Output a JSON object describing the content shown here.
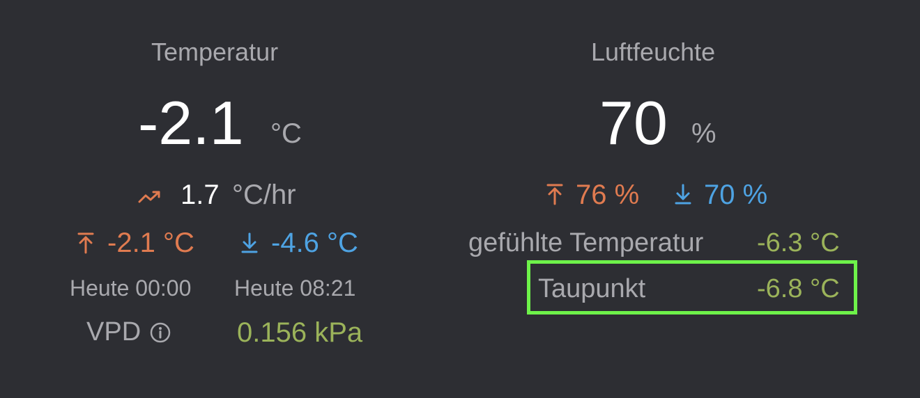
{
  "temperature": {
    "title": "Temperatur",
    "value": "-2.1",
    "unit": "°C",
    "trend_icon": "trend-up-icon",
    "trend_value": "1.7",
    "trend_unit": "°C/hr",
    "max_icon": "arrow-up-bar-icon",
    "max_value": "-2.1 °C",
    "min_icon": "arrow-down-bar-icon",
    "min_value": "-4.6 °C",
    "max_time": "Heute 00:00",
    "min_time": "Heute 08:21",
    "vpd_label": "VPD",
    "vpd_info_icon": "info-icon",
    "vpd_value": "0.156 kPa"
  },
  "humidity": {
    "title": "Luftfeuchte",
    "value": "70",
    "unit": "%",
    "max_icon": "arrow-up-bar-icon",
    "max_value": "76 %",
    "min_icon": "arrow-down-bar-icon",
    "min_value": "70 %",
    "feels_like_label": "gefühlte Temperatur",
    "feels_like_value": "-6.3 °C",
    "dewpoint_label": "Taupunkt",
    "dewpoint_value": "-6.8 °C"
  },
  "colors": {
    "background": "#2d2e33",
    "max": "#e07b50",
    "min": "#4ea3e3",
    "derived": "#9bb35a",
    "highlight": "#6ef24a"
  }
}
